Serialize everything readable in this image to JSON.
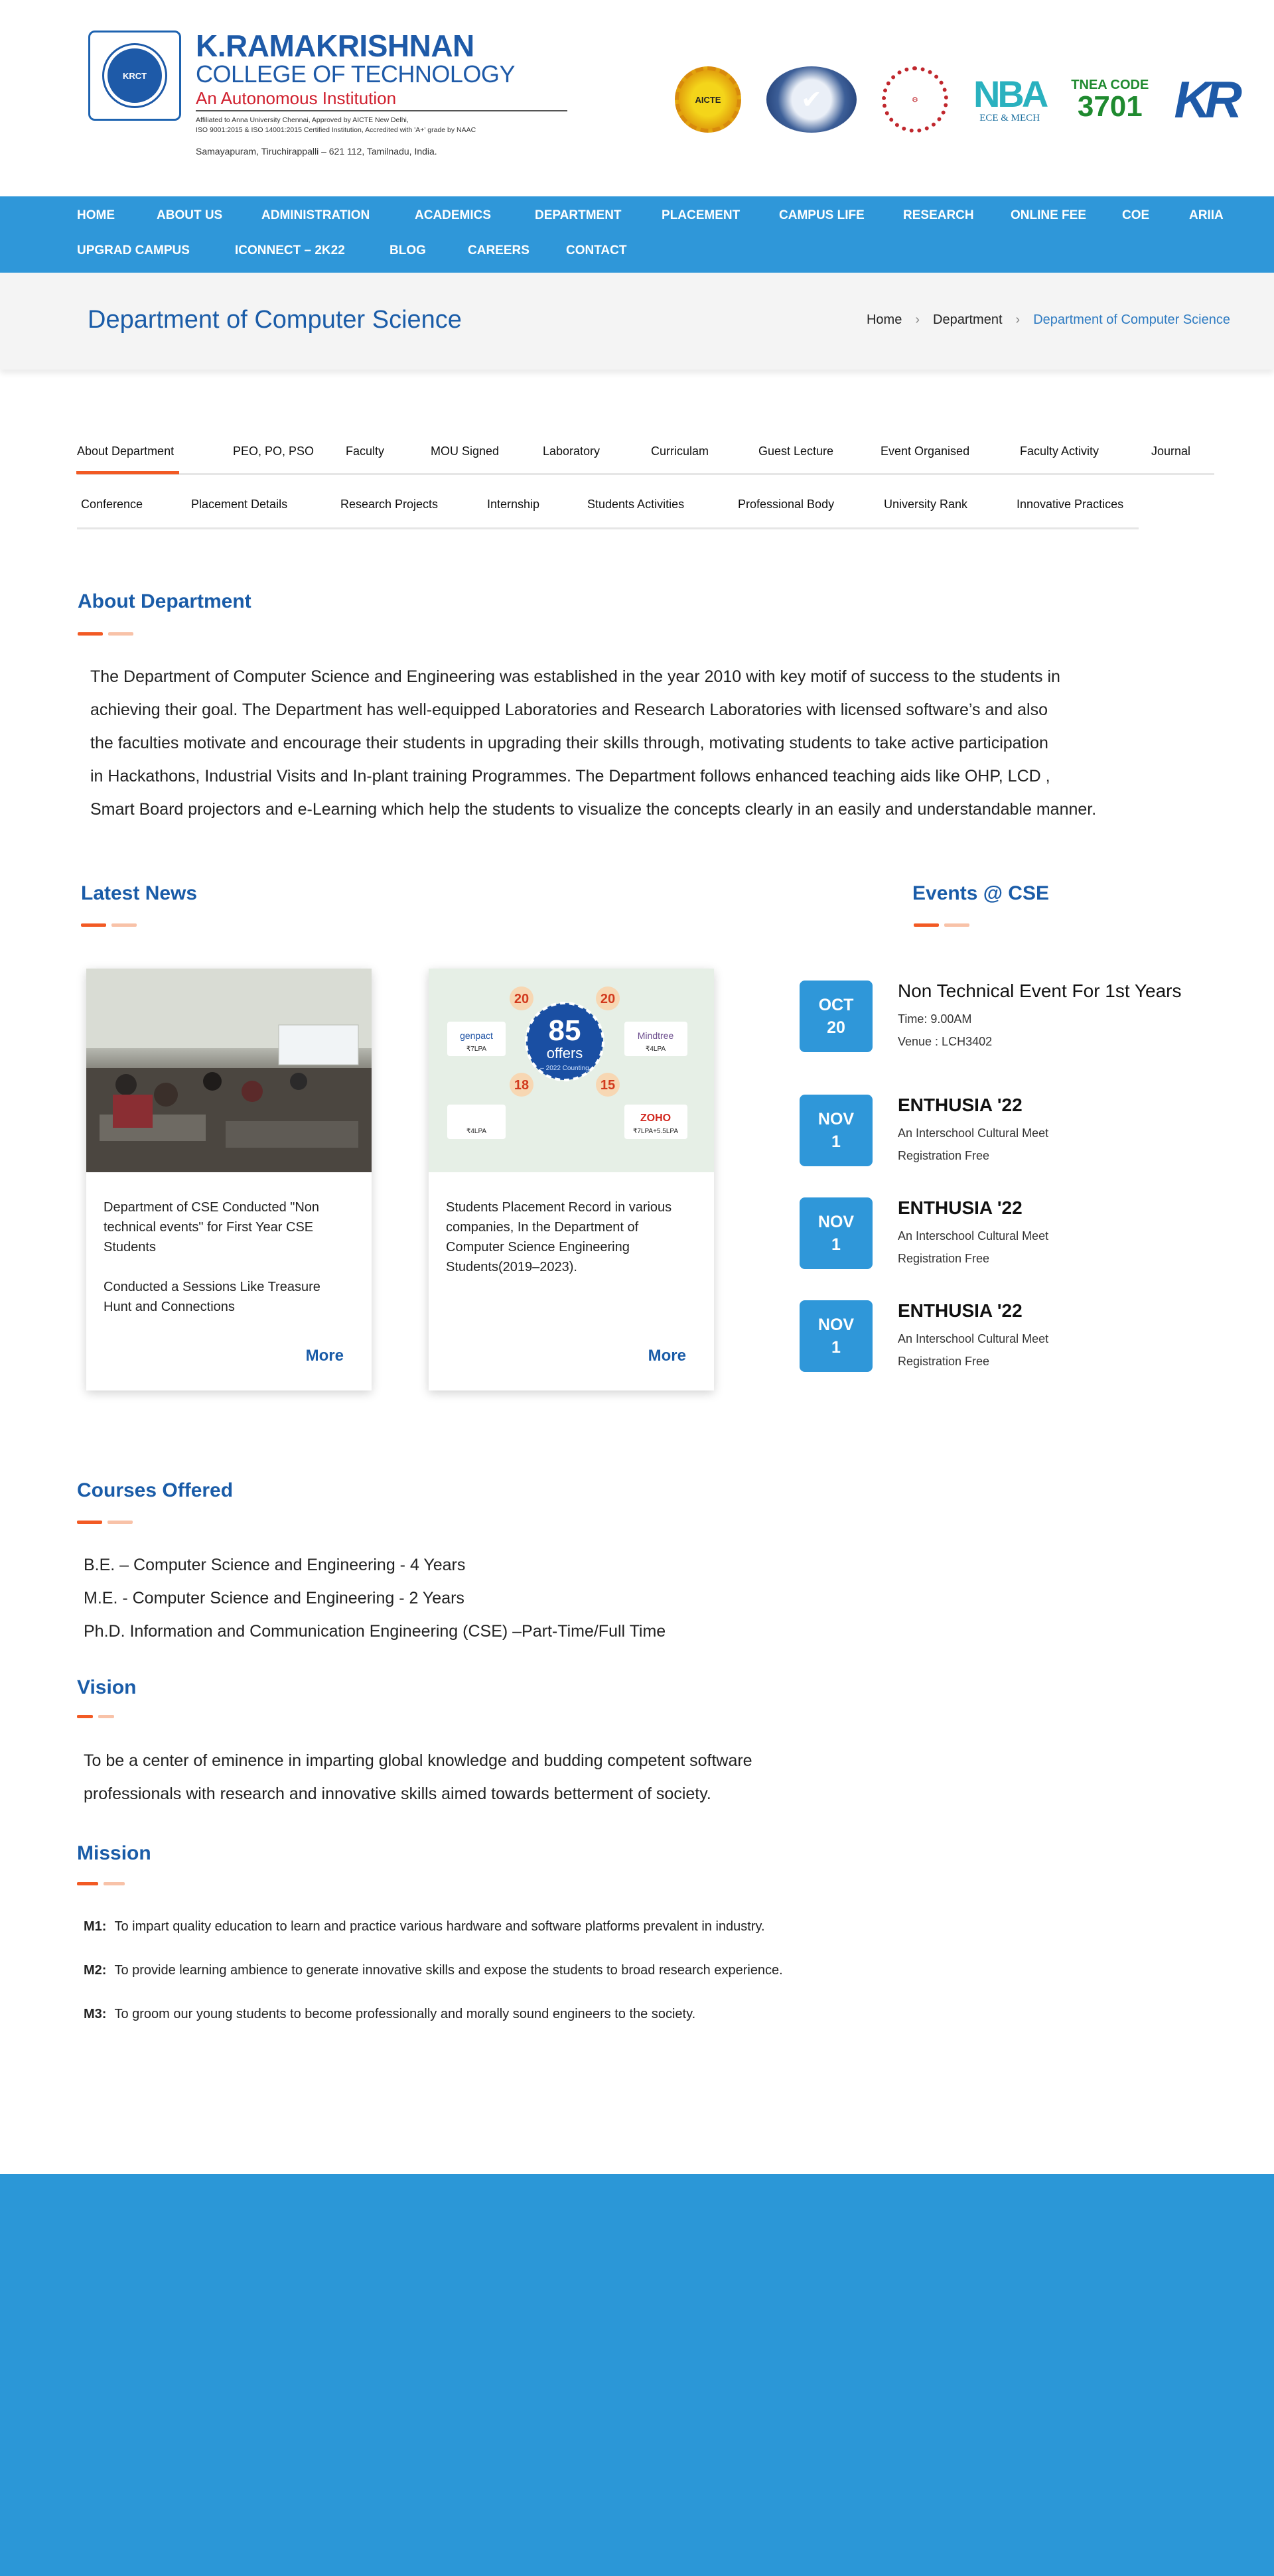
{
  "header": {
    "college_name_1": "K.RAMAKRISHNAN",
    "college_name_2": "COLLEGE OF TECHNOLOGY",
    "autonomous": "An Autonomous Institution",
    "affiliation_1": "Affiliated to Anna University Chennai, Approved by AICTE New Delhi,",
    "affiliation_2": "ISO 9001:2015 & ISO 14001:2015 Certified Institution, Accredited with 'A+' grade by NAAC",
    "address": "Samayapuram, Tiruchirappalli – 621 112, Tamilnadu, India.",
    "badges": {
      "aicte": "AICTE",
      "nba_big": "NBA",
      "nba_small": "ECE & MECH",
      "code_title": "TNEA CODE",
      "code_number": "3701",
      "kr": "KR"
    }
  },
  "nav": {
    "items": [
      "HOME",
      "ABOUT US",
      "ADMINISTRATION",
      "ACADEMICS",
      "DEPARTMENT",
      "PLACEMENT",
      "CAMPUS LIFE",
      "RESEARCH",
      "ONLINE FEE",
      "COE",
      "ARIIA",
      "UPGRAD CAMPUS",
      "ICONNECT – 2K22",
      "BLOG",
      "CAREERS",
      "CONTACT"
    ]
  },
  "page": {
    "title": "Department of Computer Science",
    "breadcrumb": [
      "Home",
      "Department",
      "Department of Computer Science"
    ]
  },
  "tabs": {
    "row1": [
      "About Department",
      "PEO, PO, PSO",
      "Faculty",
      "MOU Signed",
      "Laboratory",
      "Curriculam",
      "Guest Lecture",
      "Event Organised",
      "Faculty Activity",
      "Journal"
    ],
    "row2": [
      "Conference",
      "Placement Details",
      "Research Projects",
      "Internship",
      "Students Activities",
      "Professional Body",
      "University Rank",
      "Innovative Practices"
    ]
  },
  "about": {
    "heading": "About Department",
    "lines": [
      "The Department of Computer Science and Engineering was established in the year 2010 with key motif of success to the students in",
      "achieving their goal. The Department has well-equipped Laboratories and Research Laboratories with licensed software’s and also",
      "the faculties motivate and encourage their students in upgrading their skills through, motivating students to take active participation",
      "in Hackathons, Industrial Visits and In-plant training Programmes. The Department follows enhanced teaching aids like OHP, LCD ,",
      "Smart Board projectors and e-Learning which help the students to visualize the concepts clearly in an easily and understandable manner."
    ]
  },
  "news": {
    "heading": "Latest News",
    "cards": [
      {
        "text_1": "Department of CSE Conducted \"Non technical events\" for First Year CSE Students",
        "text_2": "Conducted a Sessions Like Treasure Hunt and Connections",
        "more": "More"
      },
      {
        "text_1": "Students Placement Record in various companies, In the Department of Computer Science Engineering Students(2019–2023).",
        "more": "More",
        "poster": {
          "count": "85",
          "offers": "offers",
          "sub": "– 2022 Counting",
          "nums": [
            "20",
            "20",
            "18",
            "15"
          ],
          "logos": [
            "genpact",
            "Mindtree",
            "ZOHO"
          ],
          "pkgs": [
            "₹7LPA",
            "₹4LPA",
            "₹4LPA",
            "₹7LPA+5.5LPA"
          ]
        }
      }
    ]
  },
  "events": {
    "heading": "Events @ CSE",
    "items": [
      {
        "month": "OCT",
        "day": "20",
        "title": "Non Technical Event For 1st Years",
        "line1": "Time: 9.00AM",
        "line2": "Venue : LCH3402"
      },
      {
        "month": "NOV",
        "day": "1",
        "title": "ENTHUSIA '22",
        "line1": "An Interschool Cultural Meet",
        "line2": "Registration Free"
      },
      {
        "month": "NOV",
        "day": "1",
        "title": "ENTHUSIA '22",
        "line1": "An Interschool Cultural Meet",
        "line2": "Registration Free"
      },
      {
        "month": "NOV",
        "day": "1",
        "title": "ENTHUSIA '22",
        "line1": "An Interschool Cultural Meet",
        "line2": "Registration Free"
      }
    ]
  },
  "courses": {
    "heading": "Courses Offered",
    "items": [
      "B.E. – Computer Science and Engineering  - 4 Years",
      "M.E. - Computer Science and Engineering   - 2 Years",
      "Ph.D. Information and Communication Engineering (CSE) –Part-Time/Full Time"
    ]
  },
  "vision": {
    "heading": "Vision",
    "lines": [
      "To be a center of eminence in imparting global knowledge and budding competent software",
      "professionals with research and innovative skills aimed towards betterment of society."
    ]
  },
  "mission": {
    "heading": "Mission",
    "items": [
      {
        "label": "M1:",
        "text": "To impart quality education to learn and practice various hardware and software platforms prevalent in industry."
      },
      {
        "label": "M2:",
        "text": "To provide learning ambience to generate innovative skills and expose the students to broad research experience."
      },
      {
        "label": "M3:",
        "text": "To groom our young students to become professionally and morally sound engineers to the society."
      }
    ]
  },
  "colors": {
    "nav_blue": "#2f97d9",
    "heading_blue": "#1a5ca8",
    "accent_orange": "#f25a24",
    "footer_blue": "#2b97d7"
  }
}
